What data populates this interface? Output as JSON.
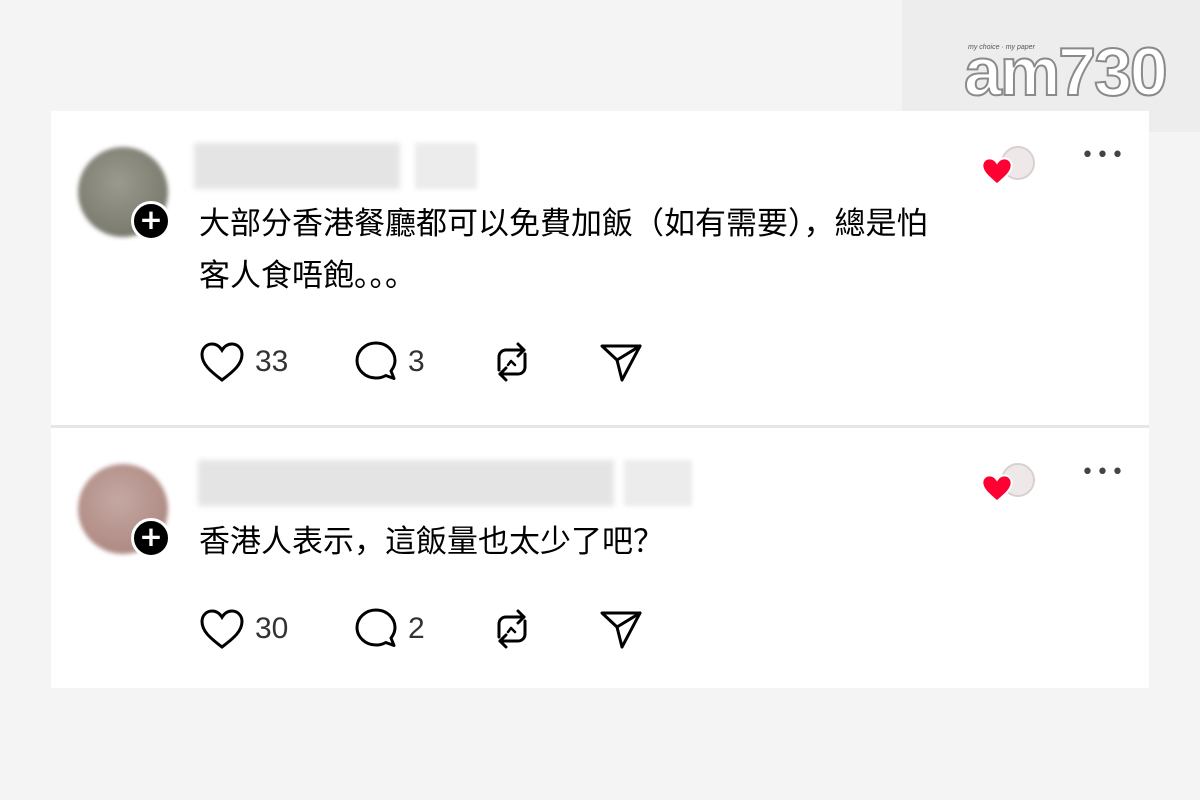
{
  "brand": {
    "name": "am730",
    "tagline": "my choice · my paper"
  },
  "posts": [
    {
      "text_line1": "大部分香港餐廳都可以免費加飯（如有需要），總是怕",
      "text_line2": "客人食唔飽。。。",
      "likes": "33",
      "replies": "3"
    },
    {
      "text_line1": "香港人表示，這飯量也太少了吧？",
      "text_line2": "",
      "likes": "30",
      "replies": "2"
    }
  ],
  "colors": {
    "heart_red": "#ff0033",
    "icon": "#000000",
    "badge": "#000000"
  },
  "icons": {
    "like": "heart-outline-icon",
    "reply": "speech-bubble-icon",
    "repost": "repost-arrows-icon",
    "share": "send-paper-plane-icon",
    "more": "more-horizontal-icon",
    "follow": "plus-icon"
  }
}
